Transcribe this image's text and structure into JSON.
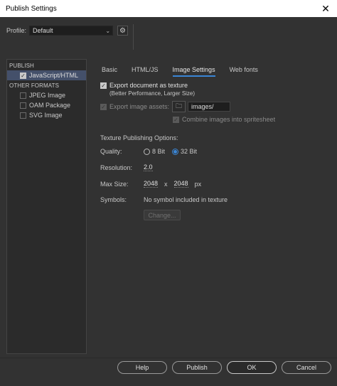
{
  "window": {
    "title": "Publish Settings",
    "close_glyph": "✕"
  },
  "profile": {
    "label": "Profile:",
    "value": "Default",
    "chevron_icon": "chevron-down-icon",
    "settings_icon": "gear-icon"
  },
  "left_panel": {
    "publish_header": "PUBLISH",
    "publish_items": [
      {
        "label": "JavaScript/HTML",
        "checked": true,
        "selected": true
      }
    ],
    "other_header": "OTHER FORMATS",
    "other_items": [
      {
        "label": "JPEG Image",
        "checked": false
      },
      {
        "label": "OAM Package",
        "checked": false
      },
      {
        "label": "SVG Image",
        "checked": false
      }
    ]
  },
  "tabs": [
    {
      "label": "Basic",
      "active": false
    },
    {
      "label": "HTML/JS",
      "active": false
    },
    {
      "label": "Image Settings",
      "active": true
    },
    {
      "label": "Web fonts",
      "active": false
    }
  ],
  "image_settings": {
    "export_texture": {
      "label": "Export document as texture",
      "checked": true,
      "note": "(Better Performance, Larger Size)"
    },
    "export_assets": {
      "label": "Export image assets:",
      "checked": true,
      "disabled": true,
      "path": "images/",
      "folder_icon": "folder-icon"
    },
    "combine": {
      "label": "Combine images into spritesheet",
      "checked": true,
      "disabled": true
    },
    "texture_header": "Texture Publishing Options:",
    "quality": {
      "label": "Quality:",
      "options": [
        "8 Bit",
        "32 Bit"
      ],
      "selected": "32 Bit"
    },
    "resolution": {
      "label": "Resolution:",
      "value": "2.0"
    },
    "max_size": {
      "label": "Max Size:",
      "width": "2048",
      "separator": "x",
      "height": "2048",
      "unit": "px"
    },
    "symbols": {
      "label": "Symbols:",
      "value": "No symbol included in texture"
    },
    "change_button": "Change..."
  },
  "footer": {
    "help": "Help",
    "publish": "Publish",
    "ok": "OK",
    "cancel": "Cancel"
  },
  "colors": {
    "accent": "#3a86d6",
    "background": "#323232",
    "selected_row": "#44506a"
  }
}
